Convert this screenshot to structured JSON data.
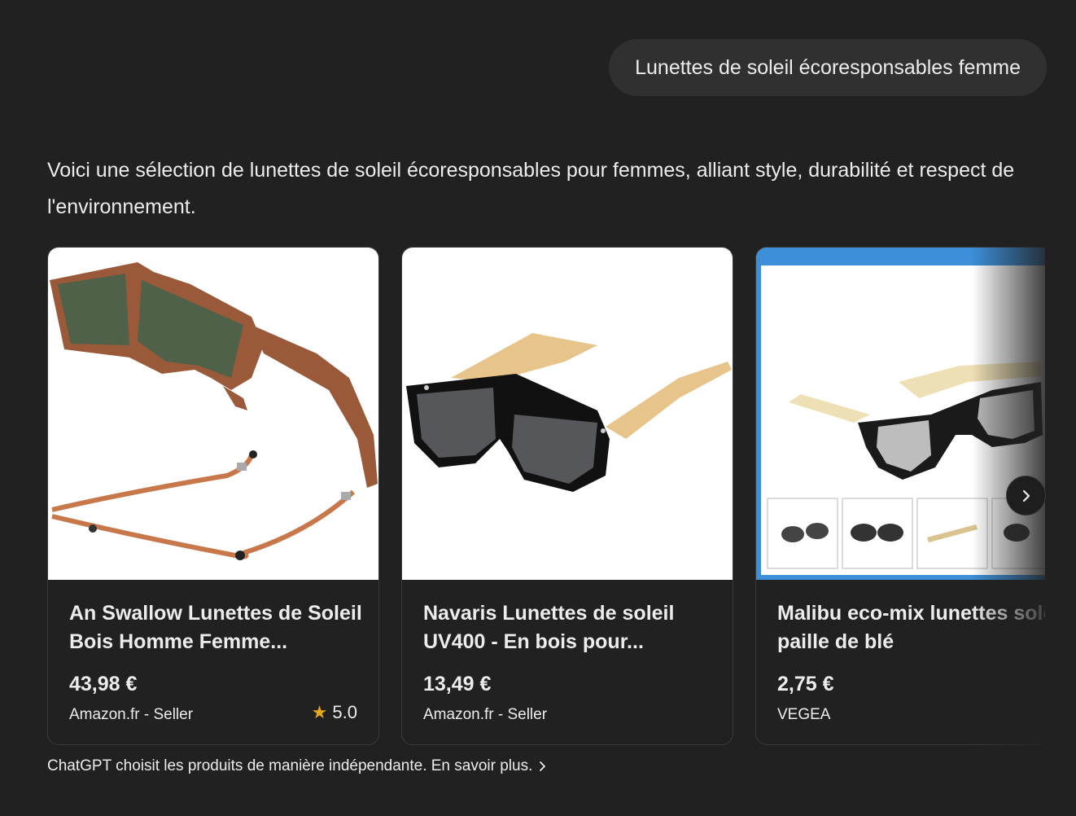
{
  "user_message": "Lunettes de soleil écoresponsables femme",
  "assistant_intro": "Voici une sélection de lunettes de soleil écoresponsables pour femmes, alliant style, durabilité et respect de l'environnement.",
  "products": [
    {
      "title": "An Swallow Lunettes de Soleil Bois Homme Femme...",
      "price": "43,98 €",
      "seller": "Amazon.fr - Seller",
      "rating": "5.0",
      "image": "wooden-sunglasses-with-cord"
    },
    {
      "title": "Navaris Lunettes de soleil UV400 - En bois pour...",
      "price": "13,49 €",
      "seller": "Amazon.fr - Seller",
      "image": "black-sunglasses-bamboo-temples"
    },
    {
      "title": "Malibu eco-mix lunettes soleil paille de blé",
      "price": "2,75 €",
      "seller": "VEGEA",
      "image": "wheat-straw-sunglasses-gallery"
    }
  ],
  "footer": {
    "disclaimer": "ChatGPT choisit les produits de manière indépendante. En savoir plus."
  },
  "icons": {
    "rating": "star-icon",
    "next": "chevron-right-icon",
    "learn_more": "chevron-right-icon"
  },
  "colors": {
    "background": "#212121",
    "bubble": "#303030",
    "star": "#e6a817"
  }
}
